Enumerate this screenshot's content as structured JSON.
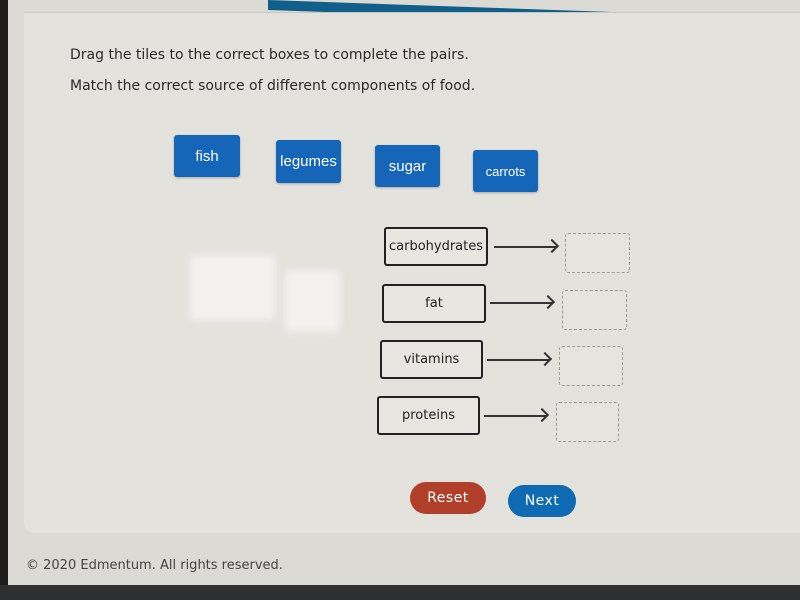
{
  "instructions": {
    "line1": "Drag the tiles to the correct boxes to complete the pairs.",
    "line2": "Match the correct source of different components of food."
  },
  "tiles": [
    {
      "label": "fish"
    },
    {
      "label": "legumes"
    },
    {
      "label": "sugar"
    },
    {
      "label": "carrots"
    }
  ],
  "pairs": [
    {
      "label": "carbohydrates",
      "target": ""
    },
    {
      "label": "fat",
      "target": ""
    },
    {
      "label": "vitamins",
      "target": ""
    },
    {
      "label": "proteins",
      "target": ""
    }
  ],
  "buttons": {
    "reset": "Reset",
    "next": "Next"
  },
  "footer": {
    "copyright": "© 2020 Edmentum. All rights reserved."
  },
  "colors": {
    "tile": "#1565b9",
    "reset": "#b0402a",
    "next": "#0e6ab3"
  }
}
